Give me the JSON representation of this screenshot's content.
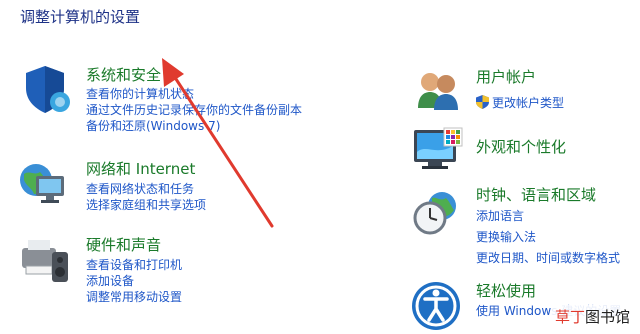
{
  "page_title": "调整计算机的设置",
  "left_categories": [
    {
      "title": "系统和安全",
      "links": [
        "查看你的计算机状态",
        "通过文件历史记录保存你的文件备份副本",
        "备份和还原(Windows 7)"
      ]
    },
    {
      "title": "网络和 Internet",
      "links": [
        "查看网络状态和任务",
        "选择家庭组和共享选项"
      ]
    },
    {
      "title": "硬件和声音",
      "links": [
        "查看设备和打印机",
        "添加设备",
        "调整常用移动设置"
      ]
    }
  ],
  "right_categories": [
    {
      "title": "用户帐户",
      "links": [
        "更改帐户类型"
      ]
    },
    {
      "title": "外观和个性化",
      "links": []
    },
    {
      "title": "时钟、语言和区域",
      "links": [
        "添加语言",
        "更换输入法",
        "更改日期、时间或数字格式"
      ]
    },
    {
      "title": "轻松使用",
      "links": [
        "使用 Windows 建议的设置"
      ]
    }
  ],
  "watermark": {
    "red_text": "草丁",
    "black_text": "图书馆"
  },
  "icons": {
    "system": "shield-icon",
    "network": "globe-network-icon",
    "hardware": "printer-speaker-icon",
    "users": "users-icon",
    "appearance": "monitor-palette-icon",
    "clock": "clock-globe-icon",
    "access": "accessibility-icon"
  },
  "colors": {
    "title": "#1e3287",
    "category": "#1a7a2a",
    "link": "#1f57c8",
    "arrow": "#e03a2e"
  }
}
